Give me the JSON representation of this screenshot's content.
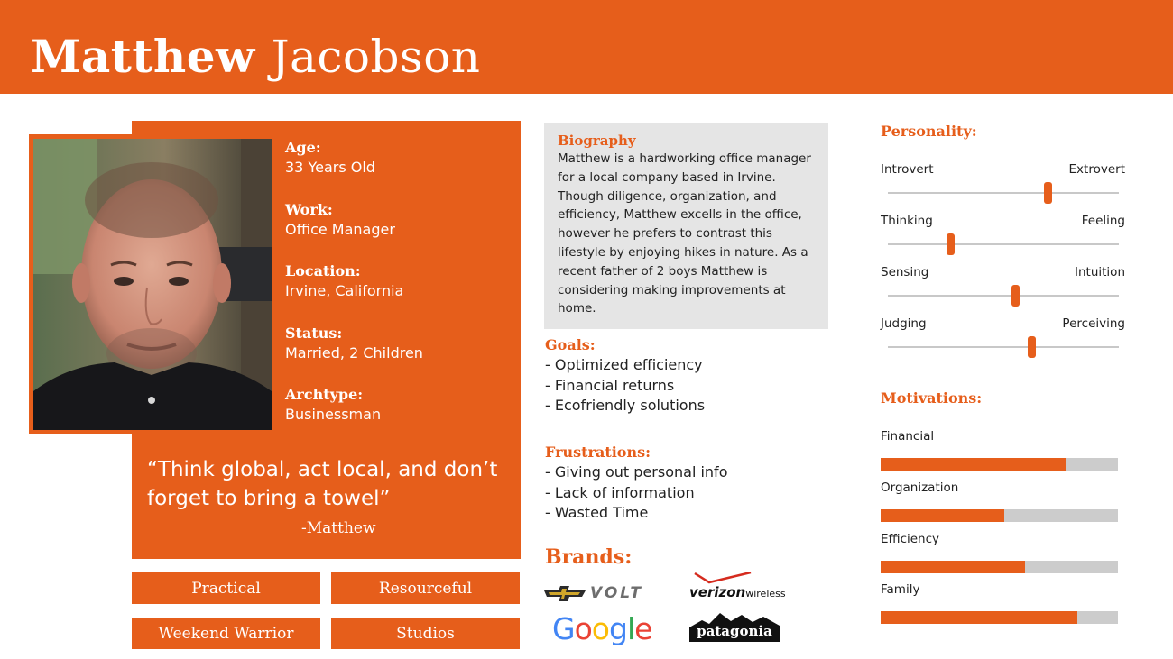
{
  "persona": {
    "first_name": "Matthew",
    "last_name": "Jacobson"
  },
  "facts": [
    {
      "label": "Age:",
      "value": "33 Years Old"
    },
    {
      "label": "Work:",
      "value": "Office Manager"
    },
    {
      "label": "Location:",
      "value": "Irvine, California"
    },
    {
      "label": "Status:",
      "value": "Married, 2 Children"
    },
    {
      "label": "Archtype:",
      "value": "Businessman"
    }
  ],
  "quote": {
    "text": "“Think global, act local, and don’t forget to bring a towel”",
    "author": "-Matthew"
  },
  "traits": [
    "Practical",
    "Resourceful",
    "Weekend Warrior",
    "Studios"
  ],
  "biography": {
    "title": "Biography",
    "text": "Matthew is a  hardworking office manager for a local company based in Irvine. Though diligence, organization, and efficiency, Matthew excells in the office, however he prefers to contrast this lifestyle by enjoying hikes in nature. As a recent father of 2 boys Matthew is considering making improvements at home."
  },
  "goals": {
    "title": "Goals:",
    "items": [
      "- Optimized efficiency",
      "- Financial returns",
      "- Ecofriendly solutions"
    ]
  },
  "frustrations": {
    "title": "Frustrations:",
    "items": [
      "- Giving out personal info",
      "- Lack of information",
      "- Wasted Time"
    ]
  },
  "brands": {
    "title": "Brands:",
    "chevrolet_volt": "VOLT",
    "verizon": "verizon",
    "verizon_suffix": "wireless",
    "google": "Google",
    "patagonia": "patagonia"
  },
  "personality": {
    "title": "Personality:",
    "scales": [
      {
        "left": "Introvert",
        "right": "Extrovert",
        "value": 0.69
      },
      {
        "left": "Thinking",
        "right": "Feeling",
        "value": 0.27
      },
      {
        "left": "Sensing",
        "right": "Intuition",
        "value": 0.55
      },
      {
        "left": "Judging",
        "right": "Perceiving",
        "value": 0.62
      }
    ]
  },
  "motivations": {
    "title": "Motivations:",
    "items": [
      {
        "label": "Financial",
        "value": 0.78
      },
      {
        "label": "Organization",
        "value": 0.52
      },
      {
        "label": "Efficiency",
        "value": 0.61
      },
      {
        "label": "Family",
        "value": 0.83
      }
    ]
  },
  "colors": {
    "accent": "#e65e1b",
    "bio_background": "#e5e5e5",
    "track": "#cccccc"
  }
}
